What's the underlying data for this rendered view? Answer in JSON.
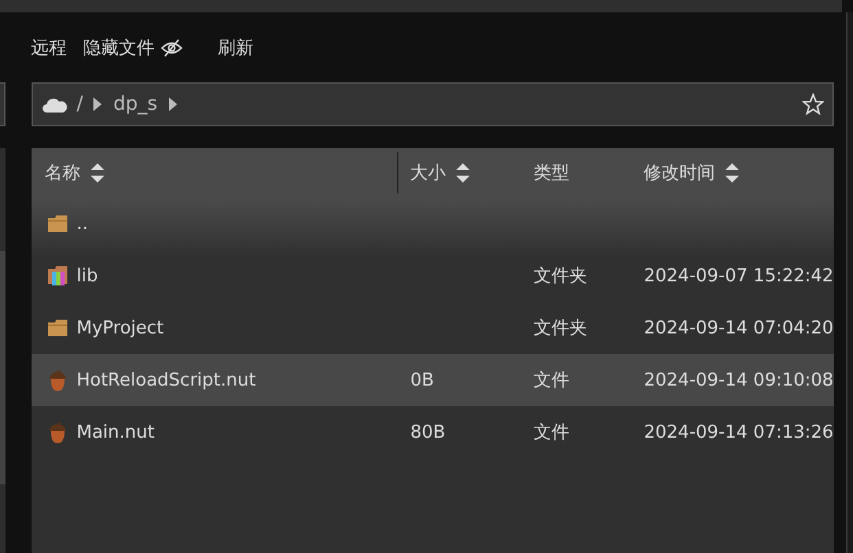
{
  "toolbar": {
    "items": [
      {
        "label": "远程",
        "kind": "text"
      },
      {
        "label": "隐藏文件",
        "kind": "toggle",
        "on": false
      },
      {
        "label": "刷新",
        "kind": "text"
      }
    ]
  },
  "path_bar": {
    "segments": [
      "/",
      "dp_s"
    ],
    "favorite": false
  },
  "table": {
    "columns": [
      {
        "label": "名称",
        "sortable": true
      },
      {
        "label": "大小",
        "sortable": true
      },
      {
        "label": "类型",
        "sortable": false
      },
      {
        "label": "修改时间",
        "sortable": true
      }
    ],
    "rows": [
      {
        "kind": "folder",
        "name": "..",
        "selected": false
      },
      {
        "kind": "library",
        "name": "lib",
        "type": "文件夹",
        "modified": "2024-09-07 15:22:42",
        "selected": false
      },
      {
        "kind": "folder",
        "name": "MyProject",
        "type": "文件夹",
        "modified": "2024-09-14 07:04:20",
        "selected": false
      },
      {
        "kind": "script",
        "name": "HotReloadScript.nut",
        "size": "0B",
        "type": "文件",
        "modified": "2024-09-14 09:10:08",
        "selected": true
      },
      {
        "kind": "script",
        "name": "Main.nut",
        "size": "80B",
        "type": "文件",
        "modified": "2024-09-14 07:13:26",
        "selected": false
      }
    ]
  }
}
